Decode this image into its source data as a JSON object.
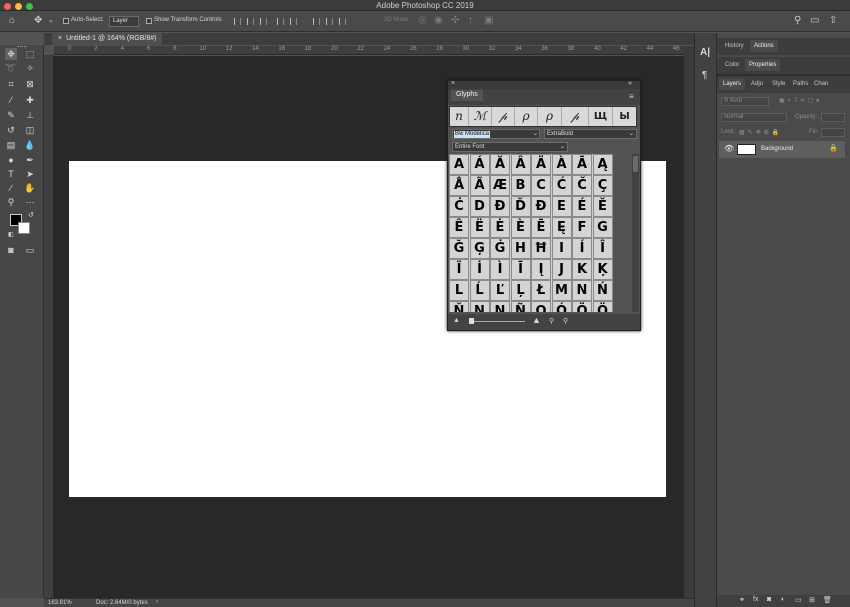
{
  "window": {
    "title": "Adobe Photoshop CC 2019"
  },
  "options_bar": {
    "auto_select_label": "Auto-Select:",
    "auto_select_value": "Layer",
    "show_transform_label": "Show Transform Controls",
    "mode_3d_label": "3D Mode:"
  },
  "document": {
    "tab_label": "Untitled-1 @ 164% (RGB/8#)"
  },
  "ruler": {
    "top_ticks": [
      "0",
      "2",
      "4",
      "6",
      "8",
      "10",
      "12",
      "14",
      "16",
      "18",
      "20",
      "22",
      "24",
      "26",
      "28",
      "30",
      "32",
      "34",
      "36",
      "38",
      "40",
      "42",
      "44",
      "46"
    ]
  },
  "glyphs_panel": {
    "title": "Glyphs",
    "recent": [
      "n",
      "ℳ",
      "𝓅",
      "ρ",
      "ρ",
      "𝓅",
      "Щ",
      "Ы"
    ],
    "font_family": "Bw Modelica",
    "font_style": "ExtraBold",
    "filter": "Entire Font",
    "glyphs": [
      [
        "A",
        "Á",
        "Ă",
        "Â",
        "Ä",
        "À",
        "Ā",
        "Ą"
      ],
      [
        "Å",
        "Ã",
        "Æ",
        "B",
        "C",
        "Ć",
        "Č",
        "Ç"
      ],
      [
        "Ċ",
        "D",
        "Ð",
        "Ď",
        "Đ",
        "E",
        "É",
        "Ě"
      ],
      [
        "Ê",
        "Ë",
        "Ė",
        "È",
        "Ē",
        "Ę",
        "F",
        "G"
      ],
      [
        "Ğ",
        "Ģ",
        "Ġ",
        "H",
        "Ħ",
        "I",
        "Í",
        "Î"
      ],
      [
        "Ï",
        "İ",
        "Ì",
        "Ī",
        "Į",
        "J",
        "K",
        "Ķ"
      ],
      [
        "L",
        "Ĺ",
        "Ľ",
        "Ļ",
        "Ł",
        "M",
        "N",
        "Ń"
      ],
      [
        "Ň",
        "Ņ",
        "N",
        "Ñ",
        "O",
        "Ó",
        "Ö",
        "Ö"
      ]
    ]
  },
  "panels": {
    "history_tab": "History",
    "actions_tab": "Actions",
    "color_tab": "Color",
    "properties_tab": "Properties",
    "layers_tabs": [
      "Layers",
      "Adju",
      "Style",
      "Paths",
      "Chan"
    ],
    "kind_placeholder": "Kind",
    "blend_mode": "Normal",
    "opacity_label": "Opacity:",
    "lock_label": "Lock:",
    "fill_label": "Fill:",
    "layer_name": "Background"
  },
  "status": {
    "zoom": "163.81%",
    "doc": "Doc: 2.64M/0 bytes"
  }
}
